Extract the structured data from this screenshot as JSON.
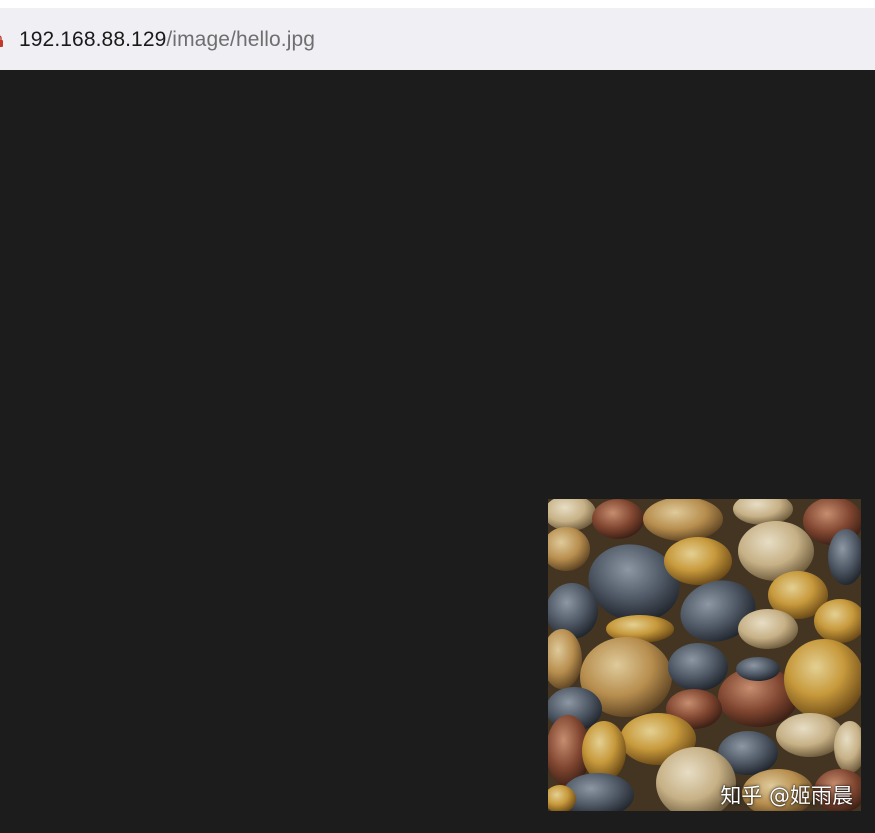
{
  "address_bar": {
    "host": "192.168.88.129",
    "path": "/image/hello.jpg"
  },
  "content": {
    "image": {
      "description_icon": "pebbles-photo",
      "watermark": "知乎 @姬雨晨"
    }
  },
  "colors": {
    "page_background": "#1c1c1c",
    "address_bar_background": "#f0eff4",
    "url_host": "#1a1a1a",
    "url_path": "#6f6f6f"
  }
}
